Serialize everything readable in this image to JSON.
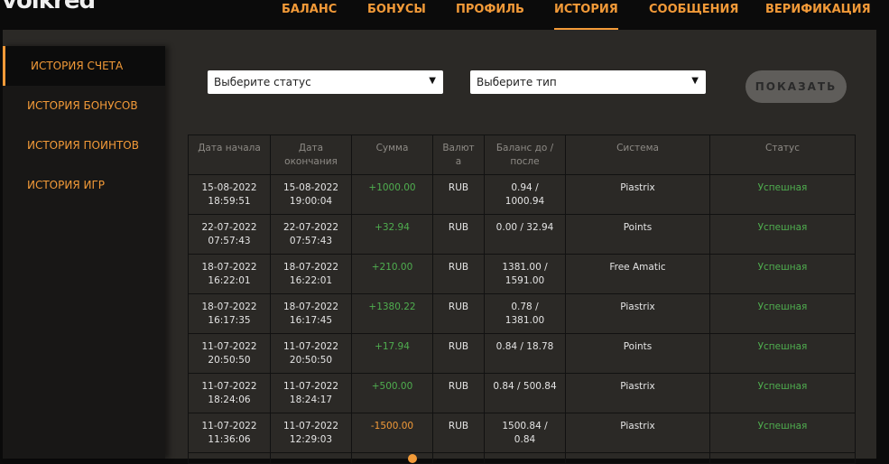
{
  "app": {
    "logo": "volkred"
  },
  "nav": [
    {
      "label": "БАЛАНС"
    },
    {
      "label": "БОНУСЫ"
    },
    {
      "label": "ПРОФИЛЬ"
    },
    {
      "label": "ИСТОРИЯ",
      "active": true
    },
    {
      "label": "СООБЩЕНИЯ"
    },
    {
      "label": "ВЕРИФИКАЦИЯ"
    }
  ],
  "sidebar": {
    "items": [
      {
        "label": "ИСТОРИЯ СЧЕТА",
        "active": true
      },
      {
        "label": "ИСТОРИЯ БОНУСОВ"
      },
      {
        "label": "ИСТОРИЯ ПОИНТОВ"
      },
      {
        "label": "ИСТОРИЯ ИГР"
      }
    ]
  },
  "filters": {
    "status_value": "Выберите статус",
    "type_value": "Выберите тип",
    "show_label": "ПОКАЗАТЬ"
  },
  "table": {
    "headers": {
      "start_date": "Дата начала",
      "end_date_1": "Дата",
      "end_date_2": "окончания",
      "amount": "Сумма",
      "currency_1": "Валют",
      "currency_2": "а",
      "balance_1": "Баланс до /",
      "balance_2": "после",
      "system": "Система",
      "status": "Статус"
    },
    "rows": [
      {
        "start_date": "15-08-2022",
        "start_time": "18:59:51",
        "end_date": "15-08-2022",
        "end_time": "19:00:04",
        "amount": "+1000.00",
        "currency": "RUB",
        "balance_1": "0.94 /",
        "balance_2": "1000.94",
        "system": "Piastrix",
        "status": "Успешная"
      },
      {
        "start_date": "22-07-2022",
        "start_time": "07:57:43",
        "end_date": "22-07-2022",
        "end_time": "07:57:43",
        "amount": "+32.94",
        "currency": "RUB",
        "balance_1": "0.00 / 32.94",
        "balance_2": "",
        "system": "Points",
        "status": "Успешная"
      },
      {
        "start_date": "18-07-2022",
        "start_time": "16:22:01",
        "end_date": "18-07-2022",
        "end_time": "16:22:01",
        "amount": "+210.00",
        "currency": "RUB",
        "balance_1": "1381.00 /",
        "balance_2": "1591.00",
        "system": "Free Amatic",
        "status": "Успешная"
      },
      {
        "start_date": "18-07-2022",
        "start_time": "16:17:35",
        "end_date": "18-07-2022",
        "end_time": "16:17:45",
        "amount": "+1380.22",
        "currency": "RUB",
        "balance_1": "0.78 /",
        "balance_2": "1381.00",
        "system": "Piastrix",
        "status": "Успешная"
      },
      {
        "start_date": "11-07-2022",
        "start_time": "20:50:50",
        "end_date": "11-07-2022",
        "end_time": "20:50:50",
        "amount": "+17.94",
        "currency": "RUB",
        "balance_1": "0.84 / 18.78",
        "balance_2": "",
        "system": "Points",
        "status": "Успешная"
      },
      {
        "start_date": "11-07-2022",
        "start_time": "18:24:06",
        "end_date": "11-07-2022",
        "end_time": "18:24:17",
        "amount": "+500.00",
        "currency": "RUB",
        "balance_1": "0.84 / 500.84",
        "balance_2": "",
        "system": "Piastrix",
        "status": "Успешная"
      },
      {
        "start_date": "11-07-2022",
        "start_time": "11:36:06",
        "end_date": "11-07-2022",
        "end_time": "12:29:03",
        "amount": "-1500.00",
        "currency": "RUB",
        "balance_1": "1500.84 /",
        "balance_2": "0.84",
        "system": "Piastrix",
        "status": "Успешная"
      }
    ]
  },
  "colors": {
    "accent": "#f29a38",
    "success": "#4fae4f",
    "panel": "#2b2926",
    "background": "#0b0b0b"
  }
}
